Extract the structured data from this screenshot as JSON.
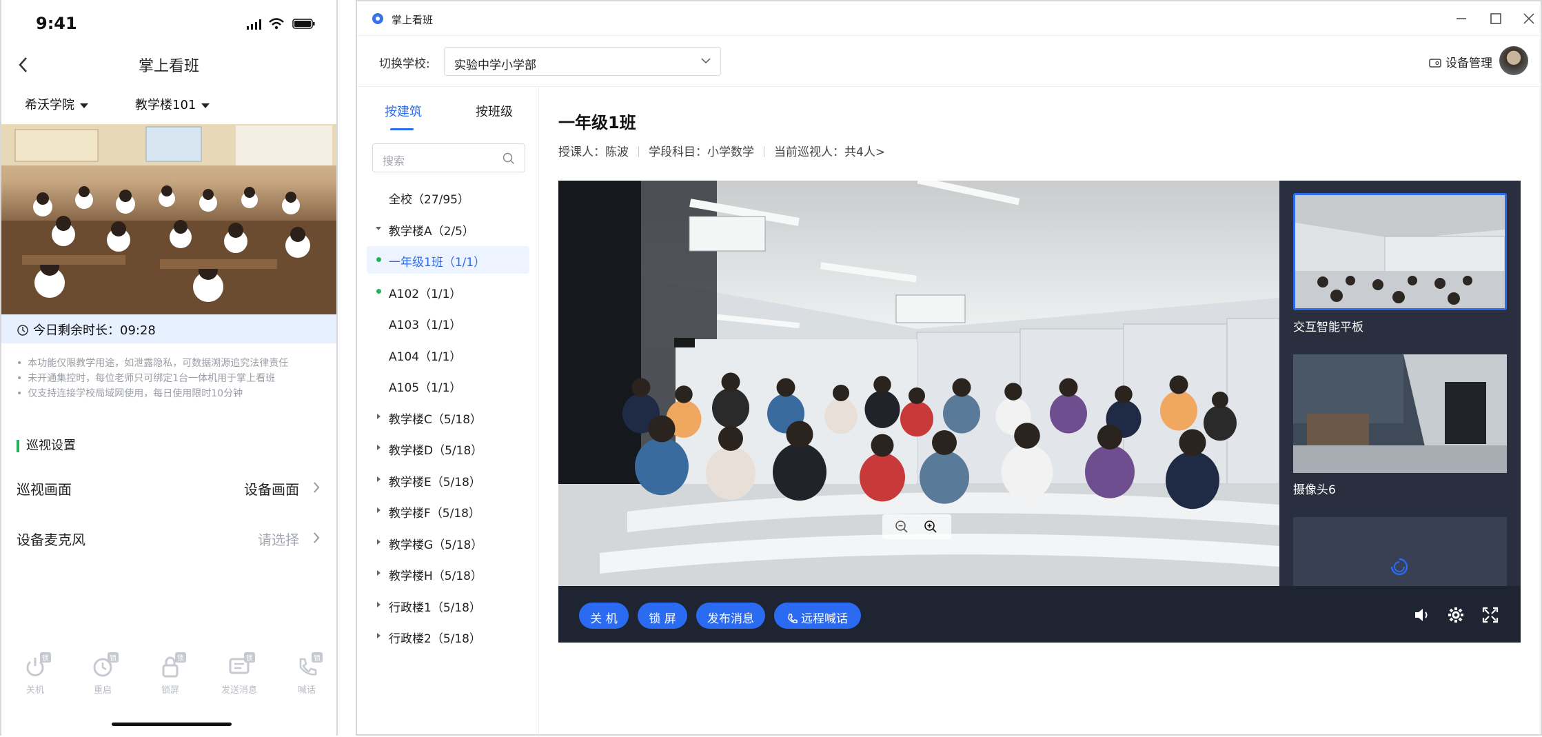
{
  "phone": {
    "status_time": "9:41",
    "nav_title": "掌上看班",
    "filters": [
      "希沃学院",
      "教学楼101"
    ],
    "remaining": "今日剩余时长：09:28",
    "notes": [
      "本功能仅限教学用途，如泄露隐私，可数据溯源追究法律责任",
      "未开通集控时，每位老师只可绑定1台一体机用于掌上看班",
      "仅支持连接学校局域网使用，每日使用限时10分钟"
    ],
    "section_title": "巡视设置",
    "settings": [
      {
        "label": "巡视画面",
        "value": "设备画面"
      },
      {
        "label": "设备麦克风",
        "value": "请选择"
      }
    ],
    "tabbar": [
      {
        "label": "关机",
        "icon": "power-icon",
        "badge": "锁"
      },
      {
        "label": "重启",
        "icon": "restart-icon",
        "badge": "锁"
      },
      {
        "label": "锁屏",
        "icon": "lock-icon",
        "badge": "锁"
      },
      {
        "label": "发送消息",
        "icon": "message-icon",
        "badge": "锁"
      },
      {
        "label": "喊话",
        "icon": "call-icon",
        "badge": "锁"
      }
    ]
  },
  "window": {
    "app_title": "掌上看班",
    "switch_label": "切换学校:",
    "school": "实验中学小学部",
    "device_mgmt": "设备管理",
    "tabs": [
      "按建筑",
      "按班级"
    ],
    "search_placeholder": "搜索",
    "tree": [
      {
        "label": "全校（27/95）",
        "expand": "none",
        "online": false,
        "active": false
      },
      {
        "label": "教学楼A（2/5）",
        "expand": "open",
        "online": false,
        "active": false
      },
      {
        "label": "一年级1班（1/1）",
        "expand": "none",
        "online": true,
        "active": true
      },
      {
        "label": "A102（1/1）",
        "expand": "none",
        "online": true,
        "active": false
      },
      {
        "label": "A103（1/1）",
        "expand": "none",
        "online": false,
        "active": false
      },
      {
        "label": "A104（1/1）",
        "expand": "none",
        "online": false,
        "active": false
      },
      {
        "label": "A105（1/1）",
        "expand": "none",
        "online": false,
        "active": false
      },
      {
        "label": "教学楼C（5/18）",
        "expand": "closed",
        "online": false,
        "active": false
      },
      {
        "label": "教学楼D（5/18）",
        "expand": "closed",
        "online": false,
        "active": false
      },
      {
        "label": "教学楼E（5/18）",
        "expand": "closed",
        "online": false,
        "active": false
      },
      {
        "label": "教学楼F（5/18）",
        "expand": "closed",
        "online": false,
        "active": false
      },
      {
        "label": "教学楼G（5/18）",
        "expand": "closed",
        "online": false,
        "active": false
      },
      {
        "label": "教学楼H（5/18）",
        "expand": "closed",
        "online": false,
        "active": false
      },
      {
        "label": "行政楼1（5/18）",
        "expand": "closed",
        "online": false,
        "active": false
      },
      {
        "label": "行政楼2（5/18）",
        "expand": "closed",
        "online": false,
        "active": false
      }
    ],
    "class_name": "一年级1班",
    "meta": {
      "teacher": "授课人：陈波",
      "subject": "学段科目：小学数学",
      "viewers": "当前巡视人：共4人>"
    },
    "thumbs": [
      {
        "caption": "交互智能平板"
      },
      {
        "caption": "摄像头6"
      }
    ],
    "controls": [
      "关 机",
      "锁 屏",
      "发布消息",
      "远程喊话"
    ],
    "colors": {
      "accent": "#2a6bf2",
      "online": "#20b35a",
      "video_bg": "#1f2433"
    }
  }
}
